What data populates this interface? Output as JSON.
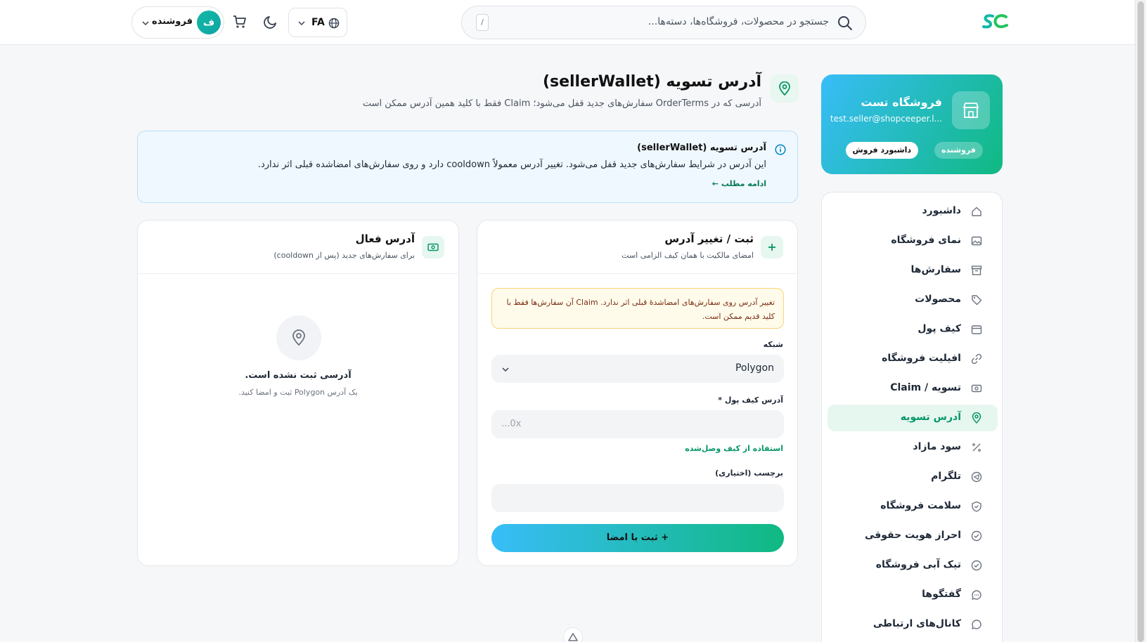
{
  "header": {
    "search_placeholder": "جستجو در محصولات، فروشگاه‌ها، دسته‌ها...",
    "search_shortcut": "/",
    "language": "FA",
    "user_initial": "ف",
    "user_role": "فروشنده"
  },
  "store": {
    "name": "فروشگاه تست",
    "email": "test.seller@shopceeper.l...",
    "chip_role": "فروشنده",
    "chip_dashboard": "داشبورد فروش"
  },
  "nav": [
    {
      "label": "داشبورد",
      "icon": "home-icon"
    },
    {
      "label": "نمای فروشگاه",
      "icon": "image-icon"
    },
    {
      "label": "سفارش‌ها",
      "icon": "archive-icon"
    },
    {
      "label": "محصولات",
      "icon": "tag-icon"
    },
    {
      "label": "کیف پول",
      "icon": "wallet-icon"
    },
    {
      "label": "افیلیت فروشگاه",
      "icon": "link-icon"
    },
    {
      "label": "تسویه / Claim",
      "icon": "banknote-icon"
    },
    {
      "label": "آدرس تسویه",
      "icon": "map-pin-icon",
      "active": true
    },
    {
      "label": "سود مازاد",
      "icon": "percent-icon"
    },
    {
      "label": "تلگرام",
      "icon": "telegram-icon"
    },
    {
      "label": "سلامت فروشگاه",
      "icon": "shield-icon"
    },
    {
      "label": "احراز هویت حقوقی",
      "icon": "check-circle-icon"
    },
    {
      "label": "تیک آبی فروشگاه",
      "icon": "badge-check-icon"
    },
    {
      "label": "گفتگوها",
      "icon": "chat-icon"
    },
    {
      "label": "کانال‌های ارتباطی",
      "icon": "message-circle-icon"
    }
  ],
  "page": {
    "title": "آدرس تسویه (sellerWallet)",
    "subtitle": "آدرسی که در OrderTerms سفارش‌های جدید قفل می‌شود؛ Claim فقط با کلید همین آدرس ممکن است"
  },
  "info": {
    "title": "آدرس تسویه (sellerWallet)",
    "text": "این آدرس در شرایط سفارش‌های جدید قفل می‌شود. تغییر آدرس معمولاً cooldown دارد و روی سفارش‌های امضاشده قبلی اثر ندارد.",
    "link": "ادامه مطلب ←"
  },
  "active_card": {
    "title": "آدرس فعال",
    "subtitle": "برای سفارش‌های جدید (پس از cooldown)",
    "empty_title": "آدرسی ثبت نشده است.",
    "empty_sub": "یک آدرس Polygon ثبت و امضا کنید."
  },
  "form_card": {
    "title": "ثبت / تغییر آدرس",
    "subtitle": "امضای مالکیت با همان کیف الزامی است",
    "warning": "تغییر آدرس روی سفارش‌های امضاشدهٔ قبلی اثر ندارد. Claim آن سفارش‌ها فقط با کلید قدیم ممکن است.",
    "network_label": "شبکه",
    "network_value": "Polygon",
    "wallet_label": "آدرس کیف پول *",
    "wallet_placeholder": "0x...",
    "use_connected": "استفاده از کیف وصل‌شده",
    "tag_label": "برچسب (اختیاری)",
    "tag_value": "",
    "submit": "+ ثبت با امضا"
  },
  "colors": {
    "accent": "#10b981",
    "accent_blue": "#38bdf8",
    "active_bg": "#e6f7ef",
    "warning_bg": "#fefbeb"
  }
}
